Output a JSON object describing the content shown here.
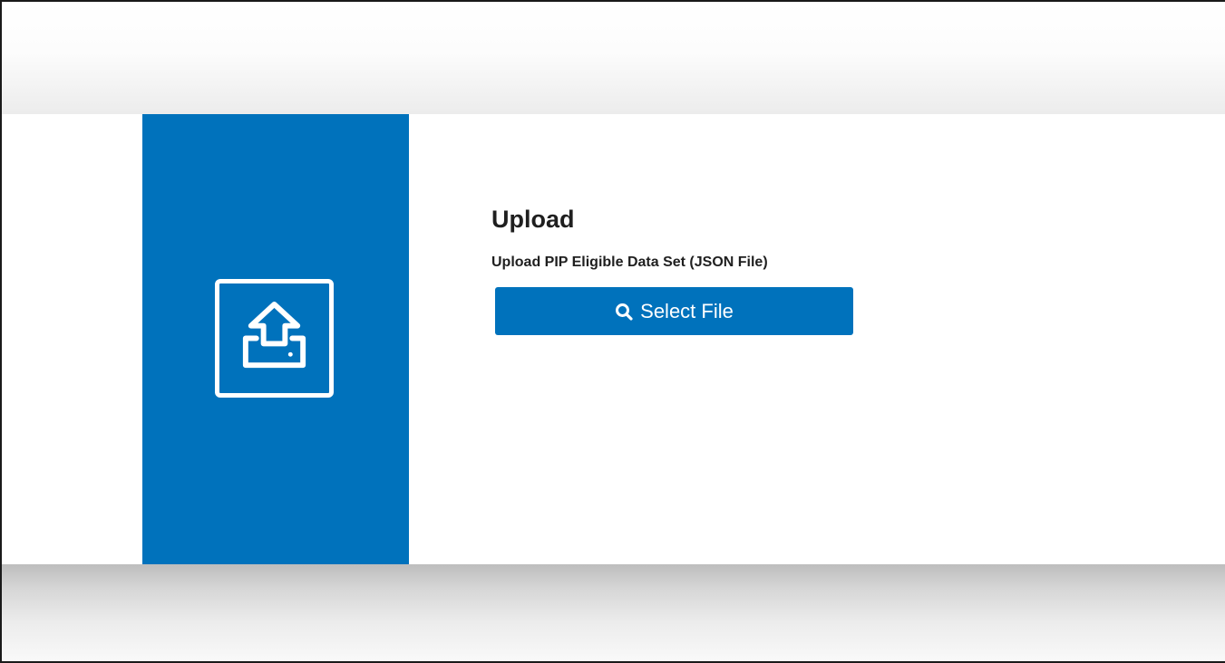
{
  "upload": {
    "title": "Upload",
    "subtitle": "Upload PIP Eligible Data Set (JSON File)",
    "select_button_label": "Select File",
    "icons": {
      "panel_icon": "upload-tray-icon",
      "button_icon": "search-icon"
    }
  },
  "colors": {
    "accent": "#0072bc",
    "text": "#1f1f1f",
    "background": "#ffffff"
  }
}
